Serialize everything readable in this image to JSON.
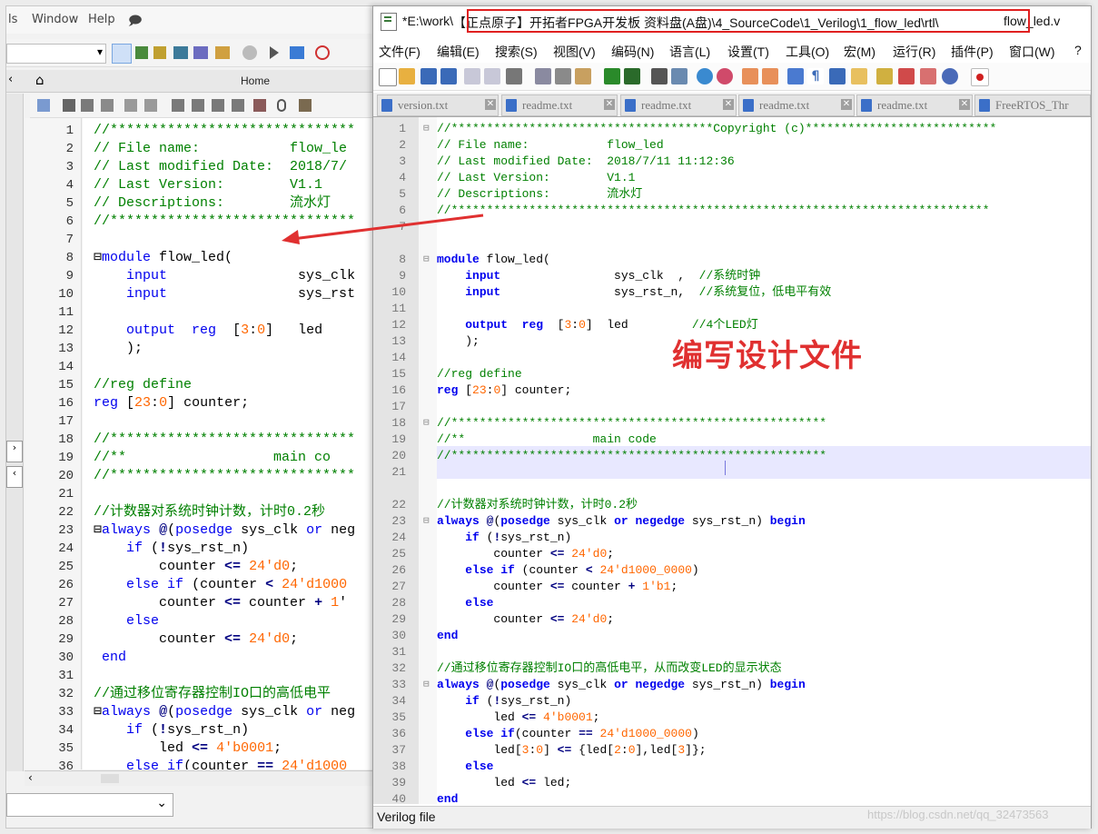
{
  "left_window": {
    "menu": [
      "ls",
      "Window",
      "Help"
    ],
    "tab_title": "Home",
    "lines": [
      {
        "n": "1",
        "t": "//******************************"
      },
      {
        "n": "2",
        "t": "// File name:           flow_le"
      },
      {
        "n": "3",
        "t": "// Last modified Date:  2018/7/"
      },
      {
        "n": "4",
        "t": "// Last Version:        V1.1"
      },
      {
        "n": "5",
        "t": "// Descriptions:        流水灯"
      },
      {
        "n": "6",
        "t": "//******************************"
      },
      {
        "n": "7",
        "t": ""
      },
      {
        "n": "8",
        "t": "⊟module flow_led("
      },
      {
        "n": "9",
        "t": "    input                sys_clk"
      },
      {
        "n": "10",
        "t": "    input                sys_rst"
      },
      {
        "n": "11",
        "t": ""
      },
      {
        "n": "12",
        "t": "    output  reg  [3:0]   led"
      },
      {
        "n": "13",
        "t": "    );"
      },
      {
        "n": "14",
        "t": ""
      },
      {
        "n": "15",
        "t": "//reg define"
      },
      {
        "n": "16",
        "t": "reg [23:0] counter;"
      },
      {
        "n": "17",
        "t": ""
      },
      {
        "n": "18",
        "t": "//******************************"
      },
      {
        "n": "19",
        "t": "//**                  main co"
      },
      {
        "n": "20",
        "t": "//******************************"
      },
      {
        "n": "21",
        "t": ""
      },
      {
        "n": "22",
        "t": "//计数器对系统时钟计数，计时0.2秒"
      },
      {
        "n": "23",
        "t": "⊟always @(posedge sys_clk or neg"
      },
      {
        "n": "24",
        "t": "    if (!sys_rst_n)"
      },
      {
        "n": "25",
        "t": "        counter <= 24'd0;"
      },
      {
        "n": "26",
        "t": "    else if (counter < 24'd1000"
      },
      {
        "n": "27",
        "t": "        counter <= counter + 1'"
      },
      {
        "n": "28",
        "t": "    else"
      },
      {
        "n": "29",
        "t": "        counter <= 24'd0;"
      },
      {
        "n": "30",
        "t": " end"
      },
      {
        "n": "31",
        "t": ""
      },
      {
        "n": "32",
        "t": "//通过移位寄存器控制IO口的高低电平"
      },
      {
        "n": "33",
        "t": "⊟always @(posedge sys_clk or neg"
      },
      {
        "n": "34",
        "t": "    if (!sys_rst_n)"
      },
      {
        "n": "35",
        "t": "        led <= 4'b0001;"
      },
      {
        "n": "36",
        "t": "    else if(counter == 24'd1000"
      }
    ]
  },
  "right_window": {
    "title_prefix": "*E:\\work\\",
    "title_highlight": "【正点原子】开拓者FPGA开发板 资料盘(A盘)\\4_SourceCode\\1_Verilog\\1_flow_led\\rtl\\",
    "title_suffix": "flow_led.v",
    "menu": [
      "文件(F)",
      "编辑(E)",
      "搜索(S)",
      "视图(V)",
      "编码(N)",
      "语言(L)",
      "设置(T)",
      "工具(O)",
      "宏(M)",
      "运行(R)",
      "插件(P)",
      "窗口(W)",
      "?"
    ],
    "tabs": [
      "version.txt",
      "readme.txt",
      "readme.txt",
      "readme.txt",
      "readme.txt",
      "FreeRTOS_Thr"
    ],
    "lines": [
      {
        "n": "1",
        "t": "//*************************************Copyright (c)***************************"
      },
      {
        "n": "2",
        "t": "// File name:           flow_led"
      },
      {
        "n": "3",
        "t": "// Last modified Date:  2018/7/11 11:12:36"
      },
      {
        "n": "4",
        "t": "// Last Version:        V1.1"
      },
      {
        "n": "5",
        "t": "// Descriptions:        流水灯"
      },
      {
        "n": "6",
        "t": "//****************************************************************************"
      },
      {
        "n": "7",
        "t": ""
      },
      {
        "n": "8",
        "t": "module flow_led("
      },
      {
        "n": "9",
        "t": "    input                sys_clk  ,  //系统时钟"
      },
      {
        "n": "10",
        "t": "    input                sys_rst_n,  //系统复位，低电平有效"
      },
      {
        "n": "11",
        "t": ""
      },
      {
        "n": "12",
        "t": "    output  reg  [3:0]  led         //4个LED灯"
      },
      {
        "n": "13",
        "t": "    );"
      },
      {
        "n": "14",
        "t": ""
      },
      {
        "n": "15",
        "t": "//reg define"
      },
      {
        "n": "16",
        "t": "reg [23:0] counter;"
      },
      {
        "n": "17",
        "t": ""
      },
      {
        "n": "18",
        "t": "//*****************************************************"
      },
      {
        "n": "19",
        "t": "//**                  main code"
      },
      {
        "n": "20",
        "t": "//*****************************************************"
      },
      {
        "n": "21",
        "t": ""
      },
      {
        "n": "22",
        "t": "//计数器对系统时钟计数，计时0.2秒"
      },
      {
        "n": "23",
        "t": "always @(posedge sys_clk or negedge sys_rst_n) begin"
      },
      {
        "n": "24",
        "t": "    if (!sys_rst_n)"
      },
      {
        "n": "25",
        "t": "        counter <= 24'd0;"
      },
      {
        "n": "26",
        "t": "    else if (counter < 24'd1000_0000)"
      },
      {
        "n": "27",
        "t": "        counter <= counter + 1'b1;"
      },
      {
        "n": "28",
        "t": "    else"
      },
      {
        "n": "29",
        "t": "        counter <= 24'd0;"
      },
      {
        "n": "30",
        "t": "end"
      },
      {
        "n": "31",
        "t": ""
      },
      {
        "n": "32",
        "t": "//通过移位寄存器控制IO口的高低电平，从而改变LED的显示状态"
      },
      {
        "n": "33",
        "t": "always @(posedge sys_clk or negedge sys_rst_n) begin"
      },
      {
        "n": "34",
        "t": "    if (!sys_rst_n)"
      },
      {
        "n": "35",
        "t": "        led <= 4'b0001;"
      },
      {
        "n": "36",
        "t": "    else if(counter == 24'd1000_0000)"
      },
      {
        "n": "37",
        "t": "        led[3:0] <= {led[2:0],led[3]};"
      },
      {
        "n": "38",
        "t": "    else"
      },
      {
        "n": "39",
        "t": "        led <= led;"
      },
      {
        "n": "40",
        "t": "end"
      }
    ],
    "status_text": "Verilog file"
  },
  "annotation_text": "编写设计文件",
  "watermark": "https://blog.csdn.net/qq_32473563",
  "colors": {
    "keyword": "#0000ee",
    "comment": "#008000",
    "number": "#ff6600",
    "highlight_border": "#e02020",
    "annotation": "#e03030"
  }
}
